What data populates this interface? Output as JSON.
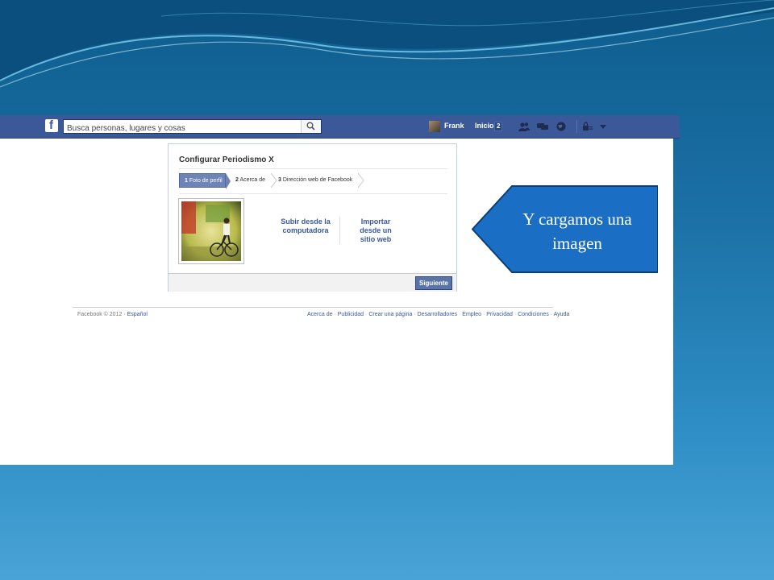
{
  "header": {
    "search_placeholder": "Busca personas, lugares y cosas",
    "user_name": "Frank",
    "home_label": "Inicio",
    "home_badge": "2"
  },
  "setup": {
    "title": "Configurar Periodismo X",
    "steps": [
      {
        "num": "1",
        "label": "Foto de perfil"
      },
      {
        "num": "2",
        "label": "Acerca de"
      },
      {
        "num": "3",
        "label": "Dirección web de Facebook"
      }
    ],
    "upload_option": "Subir desde la computadora",
    "import_option": "Importar desde un sitio web",
    "next_label": "Siguiente"
  },
  "footer": {
    "copyright": "Facebook © 2012 ·",
    "language": "Español",
    "links": [
      "Acerca de",
      "Publicidad",
      "Crear una página",
      "Desarrolladores",
      "Empleo",
      "Privacidad",
      "Condiciones",
      "Ayuda"
    ]
  },
  "callout": {
    "text": "Y cargamos una imagen"
  },
  "colors": {
    "facebook_blue": "#3b5998",
    "callout_fill": "#1a6fc4",
    "slide_background": "#1a6fa4"
  }
}
